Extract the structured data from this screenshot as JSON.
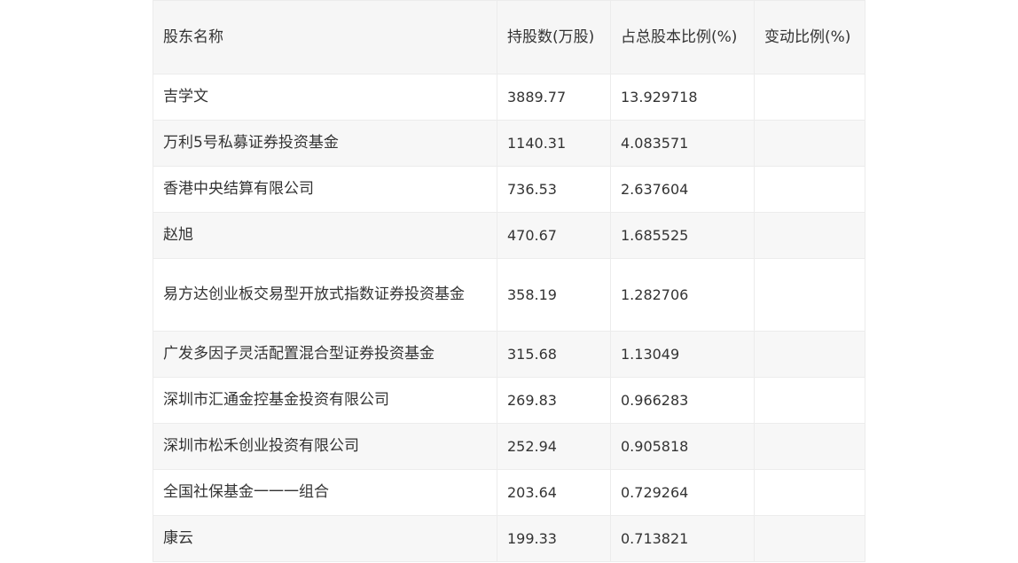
{
  "table": {
    "headers": [
      "股东名称",
      "持股数(万股)",
      "占总股本比例(%)",
      "变动比例(%)"
    ],
    "rows": [
      {
        "name": "吉学文",
        "shares": "3889.77",
        "ratio": "13.929718",
        "change": ""
      },
      {
        "name": "万利5号私募证券投资基金",
        "shares": "1140.31",
        "ratio": "4.083571",
        "change": ""
      },
      {
        "name": "香港中央结算有限公司",
        "shares": "736.53",
        "ratio": "2.637604",
        "change": ""
      },
      {
        "name": "赵旭",
        "shares": "470.67",
        "ratio": "1.685525",
        "change": ""
      },
      {
        "name": "易方达创业板交易型开放式指数证券投资基金",
        "shares": "358.19",
        "ratio": "1.282706",
        "change": ""
      },
      {
        "name": "广发多因子灵活配置混合型证券投资基金",
        "shares": "315.68",
        "ratio": "1.13049",
        "change": ""
      },
      {
        "name": "深圳市汇通金控基金投资有限公司",
        "shares": "269.83",
        "ratio": "0.966283",
        "change": ""
      },
      {
        "name": "深圳市松禾创业投资有限公司",
        "shares": "252.94",
        "ratio": "0.905818",
        "change": ""
      },
      {
        "name": "全国社保基金一一一组合",
        "shares": "203.64",
        "ratio": "0.729264",
        "change": ""
      },
      {
        "name": "康云",
        "shares": "199.33",
        "ratio": "0.713821",
        "change": ""
      }
    ]
  }
}
